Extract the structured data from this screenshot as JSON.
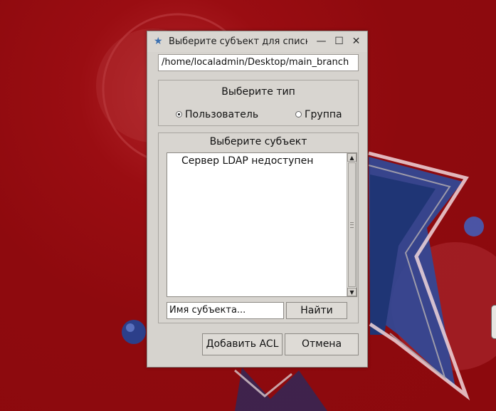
{
  "dialog": {
    "title": "Выберите субъект для списк...",
    "path": "/home/localadmin/Desktop/main_branch",
    "type_group": {
      "title": "Выберите тип",
      "options": [
        {
          "label": "Пользователь",
          "selected": true
        },
        {
          "label": "Группа",
          "selected": false
        }
      ]
    },
    "subject_group": {
      "title": "Выберите субъект",
      "list_items": [
        "Сервер LDAP недоступен"
      ],
      "name_placeholder": "Имя субъекта...",
      "find_label": "Найти"
    },
    "add_acl_label": "Добавить ACL",
    "cancel_label": "Отмена"
  },
  "colors": {
    "desktop": "#8e0a0e",
    "dialog": "#d6d3ce",
    "star_blue": "#2a4fa8"
  }
}
